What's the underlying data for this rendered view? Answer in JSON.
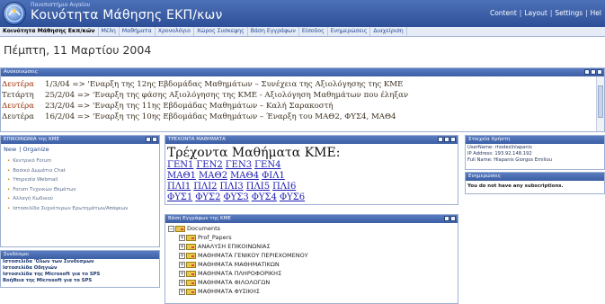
{
  "header": {
    "university": "Πανεπιστήμιο Αιγαίου",
    "site_title": "Κοινότητα Μάθησης ΕΚΠ/κων",
    "links": [
      "Content",
      "Layout",
      "Settings",
      "Hel"
    ]
  },
  "nav": {
    "tabs": [
      {
        "label": "Κοινότητα Μάθησης Εκπ/κών",
        "active": true
      },
      {
        "label": "Μέλη",
        "active": false
      },
      {
        "label": "Μαθήματα",
        "active": false
      },
      {
        "label": "Χρονολόγιο",
        "active": false
      },
      {
        "label": "Χώρος Συσκεψης",
        "active": false
      },
      {
        "label": "Βάση Εγγράφων",
        "active": false
      },
      {
        "label": "Είσοδος",
        "active": false
      },
      {
        "label": "Ενημερώσεις",
        "active": false
      },
      {
        "label": "Διαχείριση",
        "active": false
      }
    ]
  },
  "date": "Πέμπτη, 11 Μαρτίου 2004",
  "announcements": {
    "title": "Ανακοινώσεις",
    "rows": [
      {
        "day": "Δευτέρα",
        "text": "1/3/04 => 'Εναρξη της 12ης Εβδομάδας Μαθημάτων – Συνέχεια της Αξιολόγησης της ΚΜΕ"
      },
      {
        "day": "Τετάρτη",
        "text": "25/2/04 => 'Εναρξη της φάσης Αξιολόγησης της ΚΜΕ - Αξιολόγηση Μαθημάτων που έληξαν"
      },
      {
        "day": "Δευτέρα",
        "text": "23/2/04 => 'Εναρξη της 11ης Εβδομάδας Μαθημάτων – Καλή Σαρακοστή"
      },
      {
        "day": "Δευτέρα",
        "text": "16/2/04 => 'Εναρξη της 10ης Εβδομάδας Μαθημάτων – Έναρξη του ΜΑΘ2, ΦΥΣ4, ΜΑΘ4"
      }
    ]
  },
  "communication": {
    "title": "ΕΠΙΚΟΙΝΩΝΙΑ της ΚΜΕ",
    "tabs": [
      "New",
      "Organize"
    ],
    "items": [
      "Κεντρικό Forum",
      "Βασικό Δωμάτιο Chat",
      "Υπηρεσία Webmail",
      "Forum Τεχνικών Θεμάτων",
      "Αλλαγή Κωδικού",
      "Ιστοσελίδα Συχνότερων Ερωτημάτων/Απόψεων"
    ]
  },
  "useful_links": {
    "title": "Συνδέσμοι",
    "items": [
      "Ιστοσελίδα 'Όλων των Συνδέσμων",
      "Ιστοσελίδα Οδηγιών",
      "Ιστοσελίδα της Microsoft για το SPS",
      "Βοήθεια της Microsoft για το SPS"
    ]
  },
  "courses": {
    "title": "ΤΡΕΧΟΝΤΑ ΜΑΘΗΜΑΤΑ",
    "heading": "Τρέχοντα Μαθήματα ΚΜΕ:",
    "lines": [
      [
        "ΓΕΝ1",
        "ΓΕΝ2",
        "ΓΕΝ3",
        "ΓΕΝ4"
      ],
      [
        "ΜΑΘ1",
        "ΜΑΘ2",
        "ΜΑΘ4",
        "ΦΙΛ1"
      ],
      [
        "ΠΛΙ1",
        "ΠΛΙ2",
        "ΠΛΙ3",
        "ΠΛΙ5",
        "ΠΛΙ6"
      ],
      [
        "ΦΥΣ1",
        "ΦΥΣ2",
        "ΦΥΣ3",
        "ΦΥΣ4",
        "ΦΥΣ6"
      ]
    ]
  },
  "documents": {
    "title": "Βάση Εγγράφων της ΚΜΕ",
    "root": "Documents",
    "folders": [
      "Prof_Papers",
      "ΑΝΑΛΥΣΗ ΕΠΙΚΟΙΝΩΝΙΑΣ",
      "ΜΑΘΗΜΑΤΑ ΓΕΝΙΚΟΥ ΠΕΡΙΕΧΟΜΕΝΟΥ",
      "ΜΑΘΗΜΑΤΑ ΜΑΘΗΜΑΤΙΚΩΝ",
      "ΜΑΘΗΜΑΤΑ ΠΛΗΡΟΦΟΡΙΚΗΣ",
      "ΜΑΘΗΜΑΤΑ ΦΙΛΟΛΟΓΩΝ",
      "ΜΑΘΗΜΑΤΑ ΦΥΣΙΚΗΣ"
    ]
  },
  "user": {
    "title": "Στοιχεία Χρήστη",
    "username": "UserName: rhodes\\hlapanis",
    "ip": "IP Address: 193.92.148.192",
    "fullname": "Full Name: Hlapanis Giorgos Emiliou"
  },
  "subscriptions": {
    "title": "Ενημερώσεις",
    "message": "You do not have any subscriptions."
  }
}
